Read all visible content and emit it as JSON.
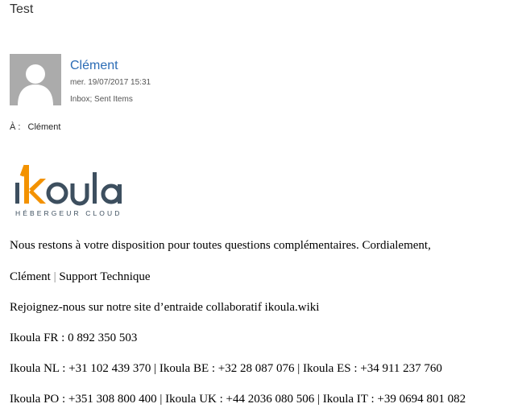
{
  "email": {
    "subject": "Test",
    "sender": {
      "name": "Clément",
      "avatar_icon": "person-placeholder-icon"
    },
    "sent_date": "mer. 19/07/2017 15:31",
    "folders": "Inbox; Sent Items",
    "to_label": "À :",
    "to_name": "Clément"
  },
  "logo": {
    "name": "ikoula",
    "tagline": "HÉBERGEUR CLOUD",
    "colors": {
      "orange": "#f39200",
      "slate": "#3d4f5f"
    }
  },
  "body": {
    "line1": "Nous restons à votre disposition pour toutes questions complémentaires. Cordialement,",
    "signature_name": "Clément",
    "signature_separator": "|",
    "signature_role": "Support Technique",
    "line3": "Rejoignez-nous sur notre site d’entraide collaboratif ikoula.wiki",
    "line4": "Ikoula FR : 0 892 350 503",
    "line5": "Ikoula NL : +31 102 439 370 | Ikoula BE : +32 28 087 076 | Ikoula ES : +34 911 237 760",
    "line6": "Ikoula PO : +351 308 800 400 | Ikoula UK : +44 2036 080 506 | Ikoula IT : +39 0694 801 082"
  },
  "colors": {
    "link_blue": "#2b6cb5",
    "avatar_bg": "#ababab"
  }
}
